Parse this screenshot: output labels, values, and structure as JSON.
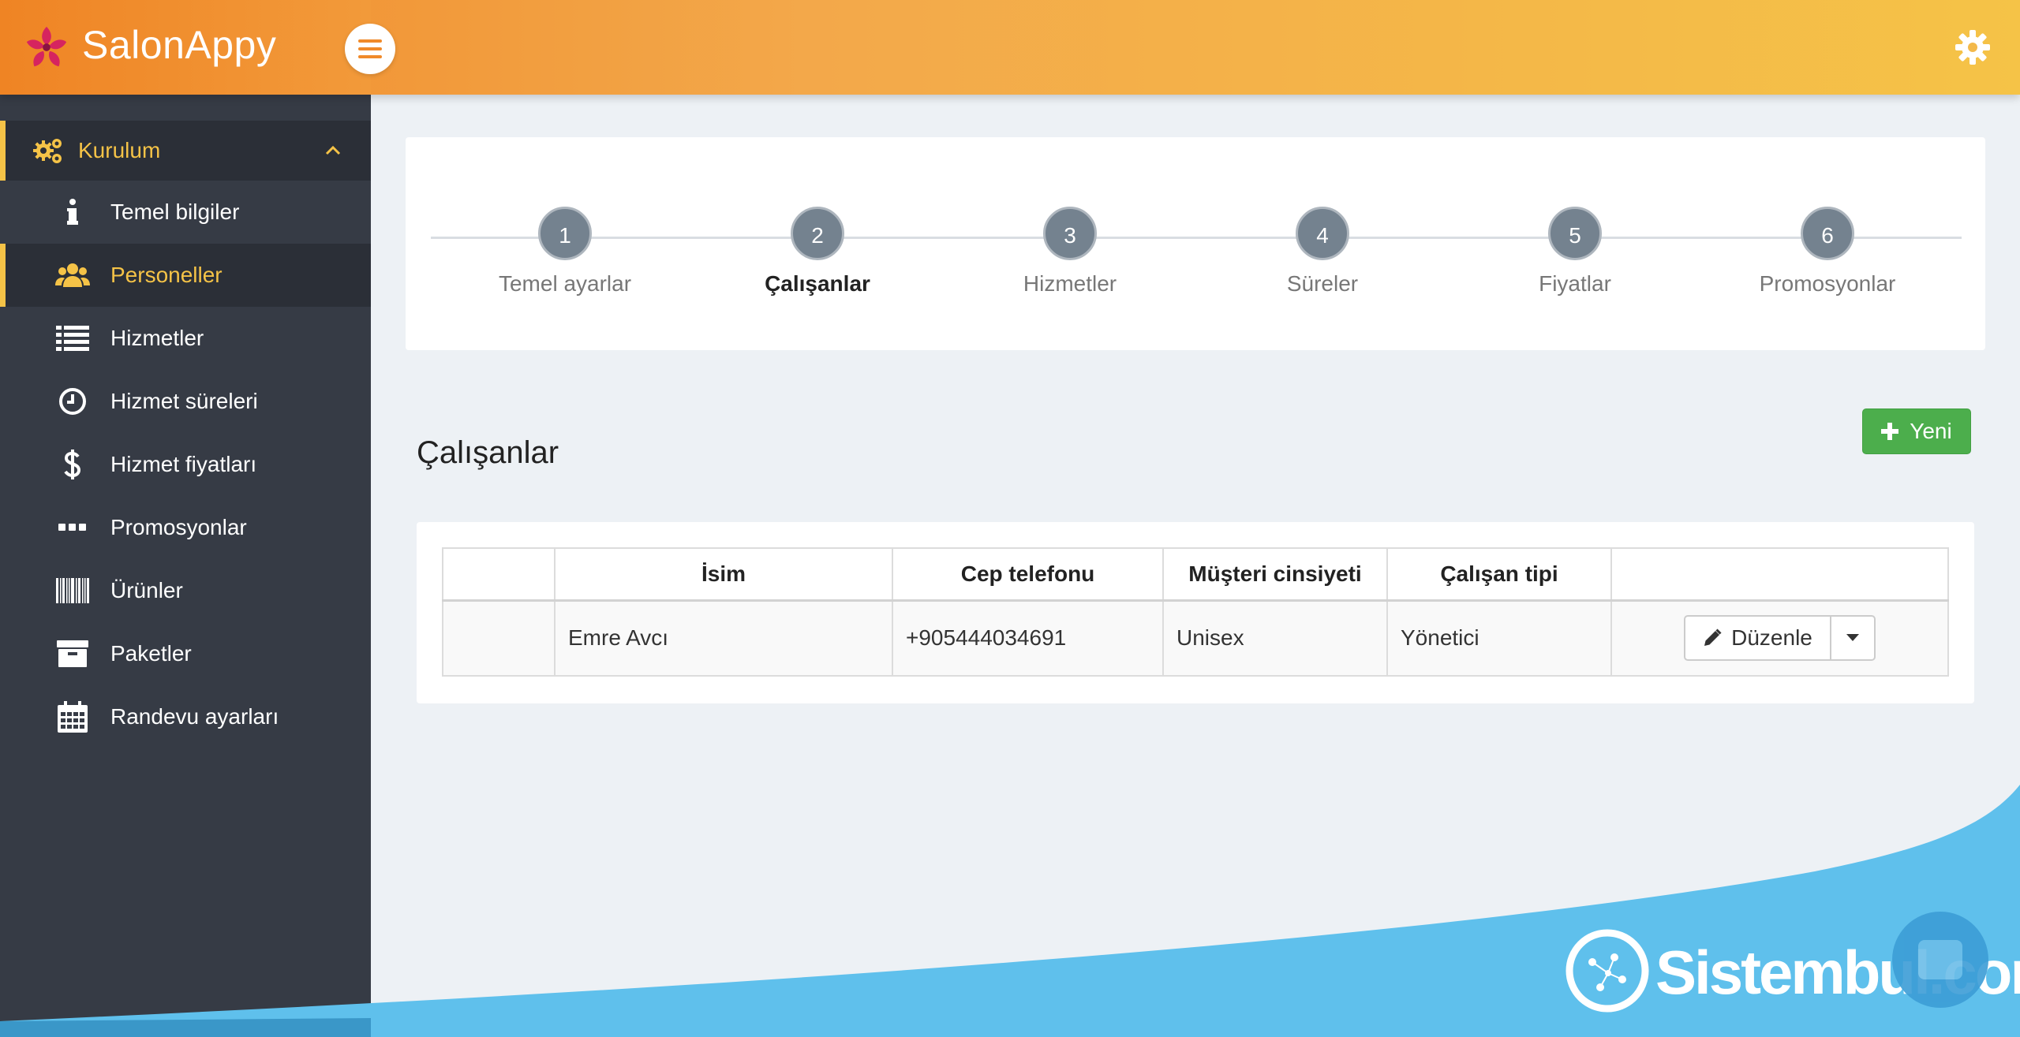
{
  "brand": {
    "name": "SalonAppy"
  },
  "sidebar": {
    "section": {
      "label": "Kurulum",
      "icon": "gears-icon"
    },
    "items": [
      {
        "label": "Temel bilgiler",
        "icon": "info-icon"
      },
      {
        "label": "Personeller",
        "icon": "users-icon",
        "active": true
      },
      {
        "label": "Hizmetler",
        "icon": "list-icon"
      },
      {
        "label": "Hizmet süreleri",
        "icon": "clock-icon"
      },
      {
        "label": "Hizmet fiyatları",
        "icon": "dollar-icon"
      },
      {
        "label": "Promosyonlar",
        "icon": "dots-icon"
      },
      {
        "label": "Ürünler",
        "icon": "barcode-icon"
      },
      {
        "label": "Paketler",
        "icon": "archive-icon"
      },
      {
        "label": "Randevu ayarları",
        "icon": "calendar-icon"
      }
    ]
  },
  "wizard": {
    "current_step": 2,
    "steps": [
      {
        "num": "1",
        "label": "Temel ayarlar"
      },
      {
        "num": "2",
        "label": "Çalışanlar"
      },
      {
        "num": "3",
        "label": "Hizmetler"
      },
      {
        "num": "4",
        "label": "Süreler"
      },
      {
        "num": "5",
        "label": "Fiyatlar"
      },
      {
        "num": "6",
        "label": "Promosyonlar"
      }
    ]
  },
  "page": {
    "title": "Çalışanlar",
    "new_button": "Yeni"
  },
  "table": {
    "headers": [
      "",
      "İsim",
      "Cep telefonu",
      "Müşteri cinsiyeti",
      "Çalışan tipi",
      ""
    ],
    "rows": [
      {
        "name": "Emre Avcı",
        "phone": "+905444034691",
        "gender": "Unisex",
        "type": "Yönetici",
        "edit_label": "Düzenle"
      }
    ]
  },
  "watermark": {
    "text": "Sistembul.com"
  },
  "colors": {
    "header_start": "#f08a2a",
    "header_end": "#f5c347",
    "sidebar_bg": "#363b45",
    "accent": "#f5c347",
    "success": "#4cae4c",
    "step_circle": "#74828f",
    "wave": "#5fc0ec"
  }
}
